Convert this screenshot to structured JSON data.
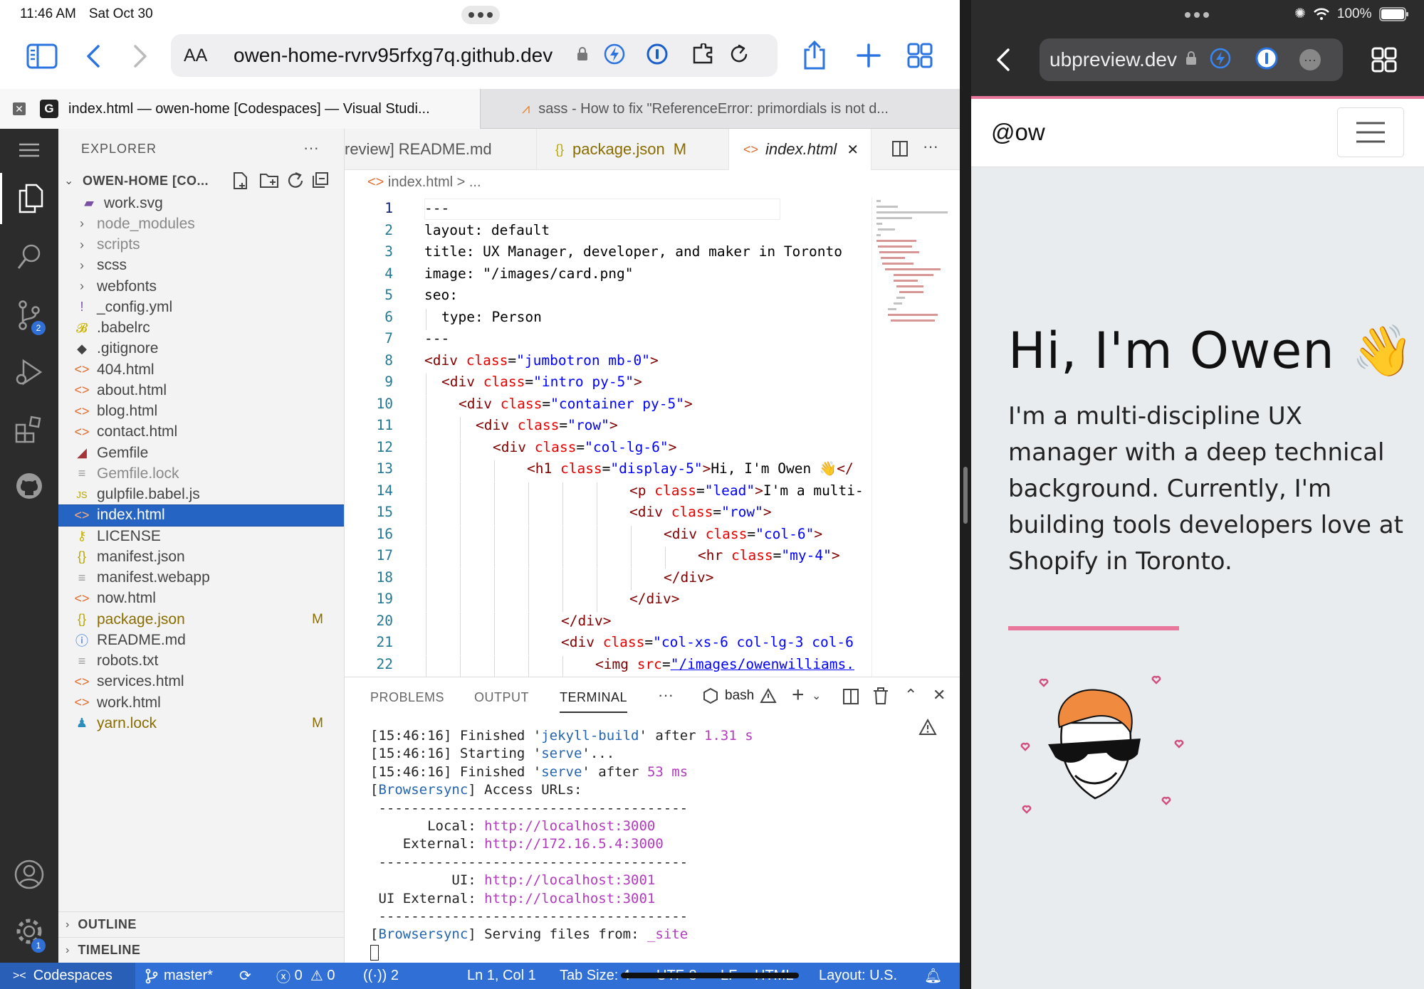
{
  "status_bar": {
    "time": "11:46 AM",
    "date": "Sat Oct 30",
    "battery": "100%"
  },
  "left_browser": {
    "aa_label": "AA",
    "url": "owen-home-rvrv95rfxg7q.github.dev",
    "tabs": [
      {
        "favicon": "G",
        "label": "index.html — owen-home [Codespaces] — Visual Studi..."
      },
      {
        "label": "sass - How to fix \"ReferenceError: primordials is not d..."
      }
    ]
  },
  "right_browser": {
    "url": "ubpreview.dev"
  },
  "vscode": {
    "explorer_title": "EXPLORER",
    "workspace_title": "OWEN-HOME [CO...",
    "activity_badges": {
      "source_control": "2",
      "settings": "1"
    },
    "files": [
      {
        "name": "work.svg",
        "icon": "svg-icon",
        "color": "#7b4fa3",
        "indent": 1
      },
      {
        "name": "node_modules",
        "icon": "chevron-right-icon",
        "color": "#666",
        "muted": true
      },
      {
        "name": "scripts",
        "icon": "chevron-right-icon",
        "color": "#666",
        "muted": true
      },
      {
        "name": "scss",
        "icon": "chevron-right-icon",
        "color": "#666"
      },
      {
        "name": "webfonts",
        "icon": "chevron-right-icon",
        "color": "#666"
      },
      {
        "name": "_config.yml",
        "icon": "yaml-icon",
        "color": "#7b4fa3"
      },
      {
        "name": ".babelrc",
        "icon": "babel-icon",
        "color": "#c9b300"
      },
      {
        "name": ".gitignore",
        "icon": "git-icon",
        "color": "#444"
      },
      {
        "name": "404.html",
        "icon": "html-icon",
        "color": "#e06c2e"
      },
      {
        "name": "about.html",
        "icon": "html-icon",
        "color": "#e06c2e"
      },
      {
        "name": "blog.html",
        "icon": "html-icon",
        "color": "#e06c2e"
      },
      {
        "name": "contact.html",
        "icon": "html-icon",
        "color": "#e06c2e"
      },
      {
        "name": "Gemfile",
        "icon": "ruby-icon",
        "color": "#a3343a"
      },
      {
        "name": "Gemfile.lock",
        "icon": "lines-icon",
        "color": "#999",
        "muted": true
      },
      {
        "name": "gulpfile.babel.js",
        "icon": "js-icon",
        "color": "#b8a500"
      },
      {
        "name": "index.html",
        "icon": "html-icon",
        "color": "#e06c2e",
        "selected": true
      },
      {
        "name": "LICENSE",
        "icon": "license-icon",
        "color": "#c9b300"
      },
      {
        "name": "manifest.json",
        "icon": "json-icon",
        "color": "#b8a500"
      },
      {
        "name": "manifest.webapp",
        "icon": "lines-icon",
        "color": "#999"
      },
      {
        "name": "now.html",
        "icon": "html-icon",
        "color": "#e06c2e"
      },
      {
        "name": "package.json",
        "icon": "json-icon",
        "color": "#b8a500",
        "modified": "M"
      },
      {
        "name": "README.md",
        "icon": "info-icon",
        "color": "#2f6fd6"
      },
      {
        "name": "robots.txt",
        "icon": "lines-icon",
        "color": "#999"
      },
      {
        "name": "services.html",
        "icon": "html-icon",
        "color": "#e06c2e"
      },
      {
        "name": "work.html",
        "icon": "html-icon",
        "color": "#e06c2e"
      },
      {
        "name": "yarn.lock",
        "icon": "yarn-icon",
        "color": "#2c8ebb",
        "modified": "M"
      }
    ],
    "outline_label": "OUTLINE",
    "timeline_label": "TIMELINE",
    "editor_tabs": [
      {
        "label": "review] README.md"
      },
      {
        "label": "package.json",
        "badge": "M"
      },
      {
        "label": "index.html",
        "active": true
      }
    ],
    "breadcrumb": "index.html > ...",
    "code_lines": [
      {
        "n": "1",
        "indent": 0,
        "parts": [
          [
            "t",
            "---"
          ]
        ]
      },
      {
        "n": "2",
        "indent": 0,
        "parts": [
          [
            "t",
            "layout: default"
          ]
        ]
      },
      {
        "n": "3",
        "indent": 0,
        "parts": [
          [
            "t",
            "title: UX Manager, developer, and maker in Toronto"
          ]
        ]
      },
      {
        "n": "4",
        "indent": 0,
        "parts": [
          [
            "t",
            "image: \"/images/card.png\""
          ]
        ]
      },
      {
        "n": "5",
        "indent": 0,
        "parts": [
          [
            "t",
            "seo:"
          ]
        ]
      },
      {
        "n": "6",
        "indent": 1,
        "parts": [
          [
            "t",
            "type: Person"
          ]
        ]
      },
      {
        "n": "7",
        "indent": 0,
        "parts": [
          [
            "t",
            "---"
          ]
        ]
      },
      {
        "n": "8",
        "indent": 0,
        "parts": [
          [
            "tag",
            "<div "
          ],
          [
            "attr",
            "class"
          ],
          [
            "t",
            "="
          ],
          [
            "str",
            "\"jumbotron mb-0\""
          ],
          [
            "tag",
            ">"
          ]
        ]
      },
      {
        "n": "9",
        "indent": 1,
        "parts": [
          [
            "tag",
            "<div "
          ],
          [
            "attr",
            "class"
          ],
          [
            "t",
            "="
          ],
          [
            "str",
            "\"intro py-5\""
          ],
          [
            "tag",
            ">"
          ]
        ]
      },
      {
        "n": "10",
        "indent": 2,
        "parts": [
          [
            "tag",
            "<div "
          ],
          [
            "attr",
            "class"
          ],
          [
            "t",
            "="
          ],
          [
            "str",
            "\"container py-5\""
          ],
          [
            "tag",
            ">"
          ]
        ]
      },
      {
        "n": "11",
        "indent": 3,
        "parts": [
          [
            "tag",
            "<div "
          ],
          [
            "attr",
            "class"
          ],
          [
            "t",
            "="
          ],
          [
            "str",
            "\"row\""
          ],
          [
            "tag",
            ">"
          ]
        ]
      },
      {
        "n": "12",
        "indent": 4,
        "parts": [
          [
            "tag",
            "<div "
          ],
          [
            "attr",
            "class"
          ],
          [
            "t",
            "="
          ],
          [
            "str",
            "\"col-lg-6\""
          ],
          [
            "tag",
            ">"
          ]
        ]
      },
      {
        "n": "13",
        "indent": 6,
        "parts": [
          [
            "tag",
            "<h1 "
          ],
          [
            "attr",
            "class"
          ],
          [
            "t",
            "="
          ],
          [
            "str",
            "\"display-5\""
          ],
          [
            "tag",
            ">"
          ],
          [
            "t",
            "Hi, I'm Owen 👋"
          ],
          [
            "tag",
            "</"
          ]
        ]
      },
      {
        "n": "14",
        "indent": 12,
        "parts": [
          [
            "tag",
            "<p "
          ],
          [
            "attr",
            "class"
          ],
          [
            "t",
            "="
          ],
          [
            "str",
            "\"lead\""
          ],
          [
            "tag",
            ">"
          ],
          [
            "t",
            "I'm a multi-"
          ]
        ]
      },
      {
        "n": "15",
        "indent": 12,
        "parts": [
          [
            "tag",
            "<div "
          ],
          [
            "attr",
            "class"
          ],
          [
            "t",
            "="
          ],
          [
            "str",
            "\"row\""
          ],
          [
            "tag",
            ">"
          ]
        ]
      },
      {
        "n": "16",
        "indent": 14,
        "parts": [
          [
            "tag",
            "<div "
          ],
          [
            "attr",
            "class"
          ],
          [
            "t",
            "="
          ],
          [
            "str",
            "\"col-6\""
          ],
          [
            "tag",
            ">"
          ]
        ]
      },
      {
        "n": "17",
        "indent": 16,
        "parts": [
          [
            "tag",
            "<hr "
          ],
          [
            "attr",
            "class"
          ],
          [
            "t",
            "="
          ],
          [
            "str",
            "\"my-4\""
          ],
          [
            "tag",
            ">"
          ]
        ]
      },
      {
        "n": "18",
        "indent": 14,
        "parts": [
          [
            "tag",
            "</div>"
          ]
        ]
      },
      {
        "n": "19",
        "indent": 12,
        "parts": [
          [
            "tag",
            "</div>"
          ]
        ]
      },
      {
        "n": "20",
        "indent": 8,
        "parts": [
          [
            "tag",
            "</div>"
          ]
        ]
      },
      {
        "n": "21",
        "indent": 8,
        "parts": [
          [
            "tag",
            "<div "
          ],
          [
            "attr",
            "class"
          ],
          [
            "t",
            "="
          ],
          [
            "str",
            "\"col-xs-6 col-lg-3 col-6"
          ]
        ]
      },
      {
        "n": "22",
        "indent": 10,
        "parts": [
          [
            "tag",
            "<img "
          ],
          [
            "attr",
            "src"
          ],
          [
            "t",
            "="
          ],
          [
            "link",
            "\"/images/owenwilliams."
          ]
        ]
      }
    ],
    "panel_tabs": [
      "PROBLEMS",
      "OUTPUT",
      "TERMINAL"
    ],
    "active_panel_tab": "TERMINAL",
    "terminal_shell": "bash",
    "terminal_lines": [
      [
        [
          "t",
          "[15:46:16] Finished '"
        ],
        [
          "b",
          "jekyll-build"
        ],
        [
          "t",
          "' after "
        ],
        [
          "p",
          "1.31 s"
        ]
      ],
      [
        [
          "t",
          "[15:46:16] Starting '"
        ],
        [
          "b",
          "serve"
        ],
        [
          "t",
          "'..."
        ]
      ],
      [
        [
          "t",
          "[15:46:16] Finished '"
        ],
        [
          "b",
          "serve"
        ],
        [
          "t",
          "' after "
        ],
        [
          "p",
          "53 ms"
        ]
      ],
      [
        [
          "t",
          "["
        ],
        [
          "b",
          "Browsersync"
        ],
        [
          "t",
          "] Access URLs:"
        ]
      ],
      [
        [
          "t",
          " --------------------------------------"
        ]
      ],
      [
        [
          "t",
          "       Local: "
        ],
        [
          "p",
          "http://localhost:3000"
        ]
      ],
      [
        [
          "t",
          "    External: "
        ],
        [
          "p",
          "http://172.16.5.4:3000"
        ]
      ],
      [
        [
          "t",
          " --------------------------------------"
        ]
      ],
      [
        [
          "t",
          "          UI: "
        ],
        [
          "p",
          "http://localhost:3001"
        ]
      ],
      [
        [
          "t",
          " UI External: "
        ],
        [
          "p",
          "http://localhost:3001"
        ]
      ],
      [
        [
          "t",
          " --------------------------------------"
        ]
      ],
      [
        [
          "t",
          "["
        ],
        [
          "b",
          "Browsersync"
        ],
        [
          "t",
          "] Serving files from: "
        ],
        [
          "p",
          "_site"
        ]
      ]
    ],
    "statusbar": {
      "remote": "Codespaces",
      "branch": "master*",
      "errors": "0",
      "warnings": "0",
      "ports": "2",
      "position": "Ln 1, Col 1",
      "tab_size": "Tab Size: 4",
      "encoding": "UTF-8",
      "eol": "LF",
      "language": "HTML",
      "layout": "Layout: U.S."
    }
  },
  "preview": {
    "brand": "@ow",
    "heading": "Hi, I'm Owen 👋",
    "lead": "I'm a multi-discipline UX manager with a deep technical background. Currently, I'm building tools developers love at Shopify in Toronto.",
    "accent_color": "#e9779c"
  }
}
